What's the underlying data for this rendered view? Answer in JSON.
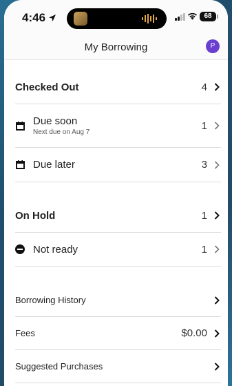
{
  "status": {
    "time": "4:46",
    "battery": "68"
  },
  "header": {
    "title": "My Borrowing",
    "avatar_initial": "P"
  },
  "checked_out": {
    "label": "Checked Out",
    "count": "4",
    "due_soon": {
      "label": "Due soon",
      "sublabel": "Next due on Aug 7",
      "count": "1"
    },
    "due_later": {
      "label": "Due later",
      "count": "3"
    }
  },
  "on_hold": {
    "label": "On Hold",
    "count": "1",
    "not_ready": {
      "label": "Not ready",
      "count": "1"
    }
  },
  "links": {
    "borrowing_history": "Borrowing History",
    "fees_label": "Fees",
    "fees_value": "$0.00",
    "suggested_purchases": "Suggested Purchases"
  }
}
